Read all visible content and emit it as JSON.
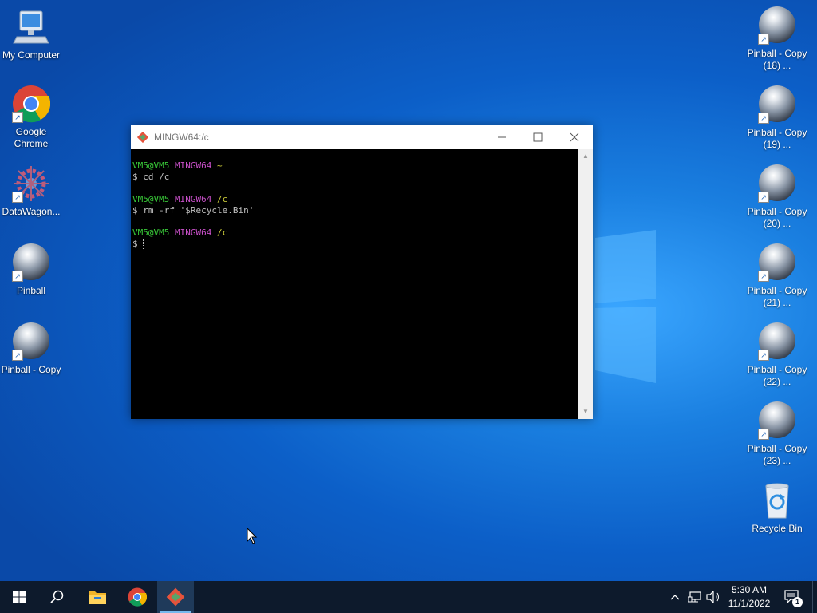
{
  "desktop": {
    "left_icons": [
      {
        "label": "My Computer",
        "icon": "computer-icon"
      },
      {
        "label": "Google Chrome",
        "icon": "chrome-icon"
      },
      {
        "label": "DataWagon...",
        "icon": "datawagon-icon"
      },
      {
        "label": "Pinball",
        "icon": "pinball-icon"
      },
      {
        "label": "Pinball - Copy",
        "icon": "pinball-icon"
      }
    ],
    "right_icons": [
      {
        "label": "Pinball - Copy (18) ...",
        "icon": "pinball-icon"
      },
      {
        "label": "Pinball - Copy (19) ...",
        "icon": "pinball-icon"
      },
      {
        "label": "Pinball - Copy (20) ...",
        "icon": "pinball-icon"
      },
      {
        "label": "Pinball - Copy (21) ...",
        "icon": "pinball-icon"
      },
      {
        "label": "Pinball - Copy (22) ...",
        "icon": "pinball-icon"
      },
      {
        "label": "Pinball - Copy (23) ...",
        "icon": "pinball-icon"
      },
      {
        "label": "Recycle Bin",
        "icon": "recycle-bin-icon"
      }
    ]
  },
  "terminal": {
    "title": "MINGW64:/c",
    "lines": [
      {
        "user": "VM5@VM5",
        "host": "MINGW64",
        "path": "~"
      },
      {
        "cmd": "$ cd /c"
      },
      {
        "blank": true
      },
      {
        "user": "VM5@VM5",
        "host": "MINGW64",
        "path": "/c"
      },
      {
        "cmd": "$ rm -rf '$Recycle.Bin'"
      },
      {
        "blank": true
      },
      {
        "user": "VM5@VM5",
        "host": "MINGW64",
        "path": "/c"
      },
      {
        "prompt": "$ "
      }
    ],
    "colors": {
      "user": "#38c838",
      "host": "#c850c8",
      "path": "#c8c838",
      "background": "#000000"
    }
  },
  "taskbar": {
    "apps": [
      "start-icon",
      "search-icon",
      "file-explorer-icon",
      "chrome-icon",
      "git-bash-icon"
    ],
    "clock": {
      "time": "5:30 AM",
      "date": "11/1/2022"
    },
    "notification_count": "1",
    "colors": {
      "background": "#0d1a2c",
      "active": "#76b9ed"
    }
  }
}
